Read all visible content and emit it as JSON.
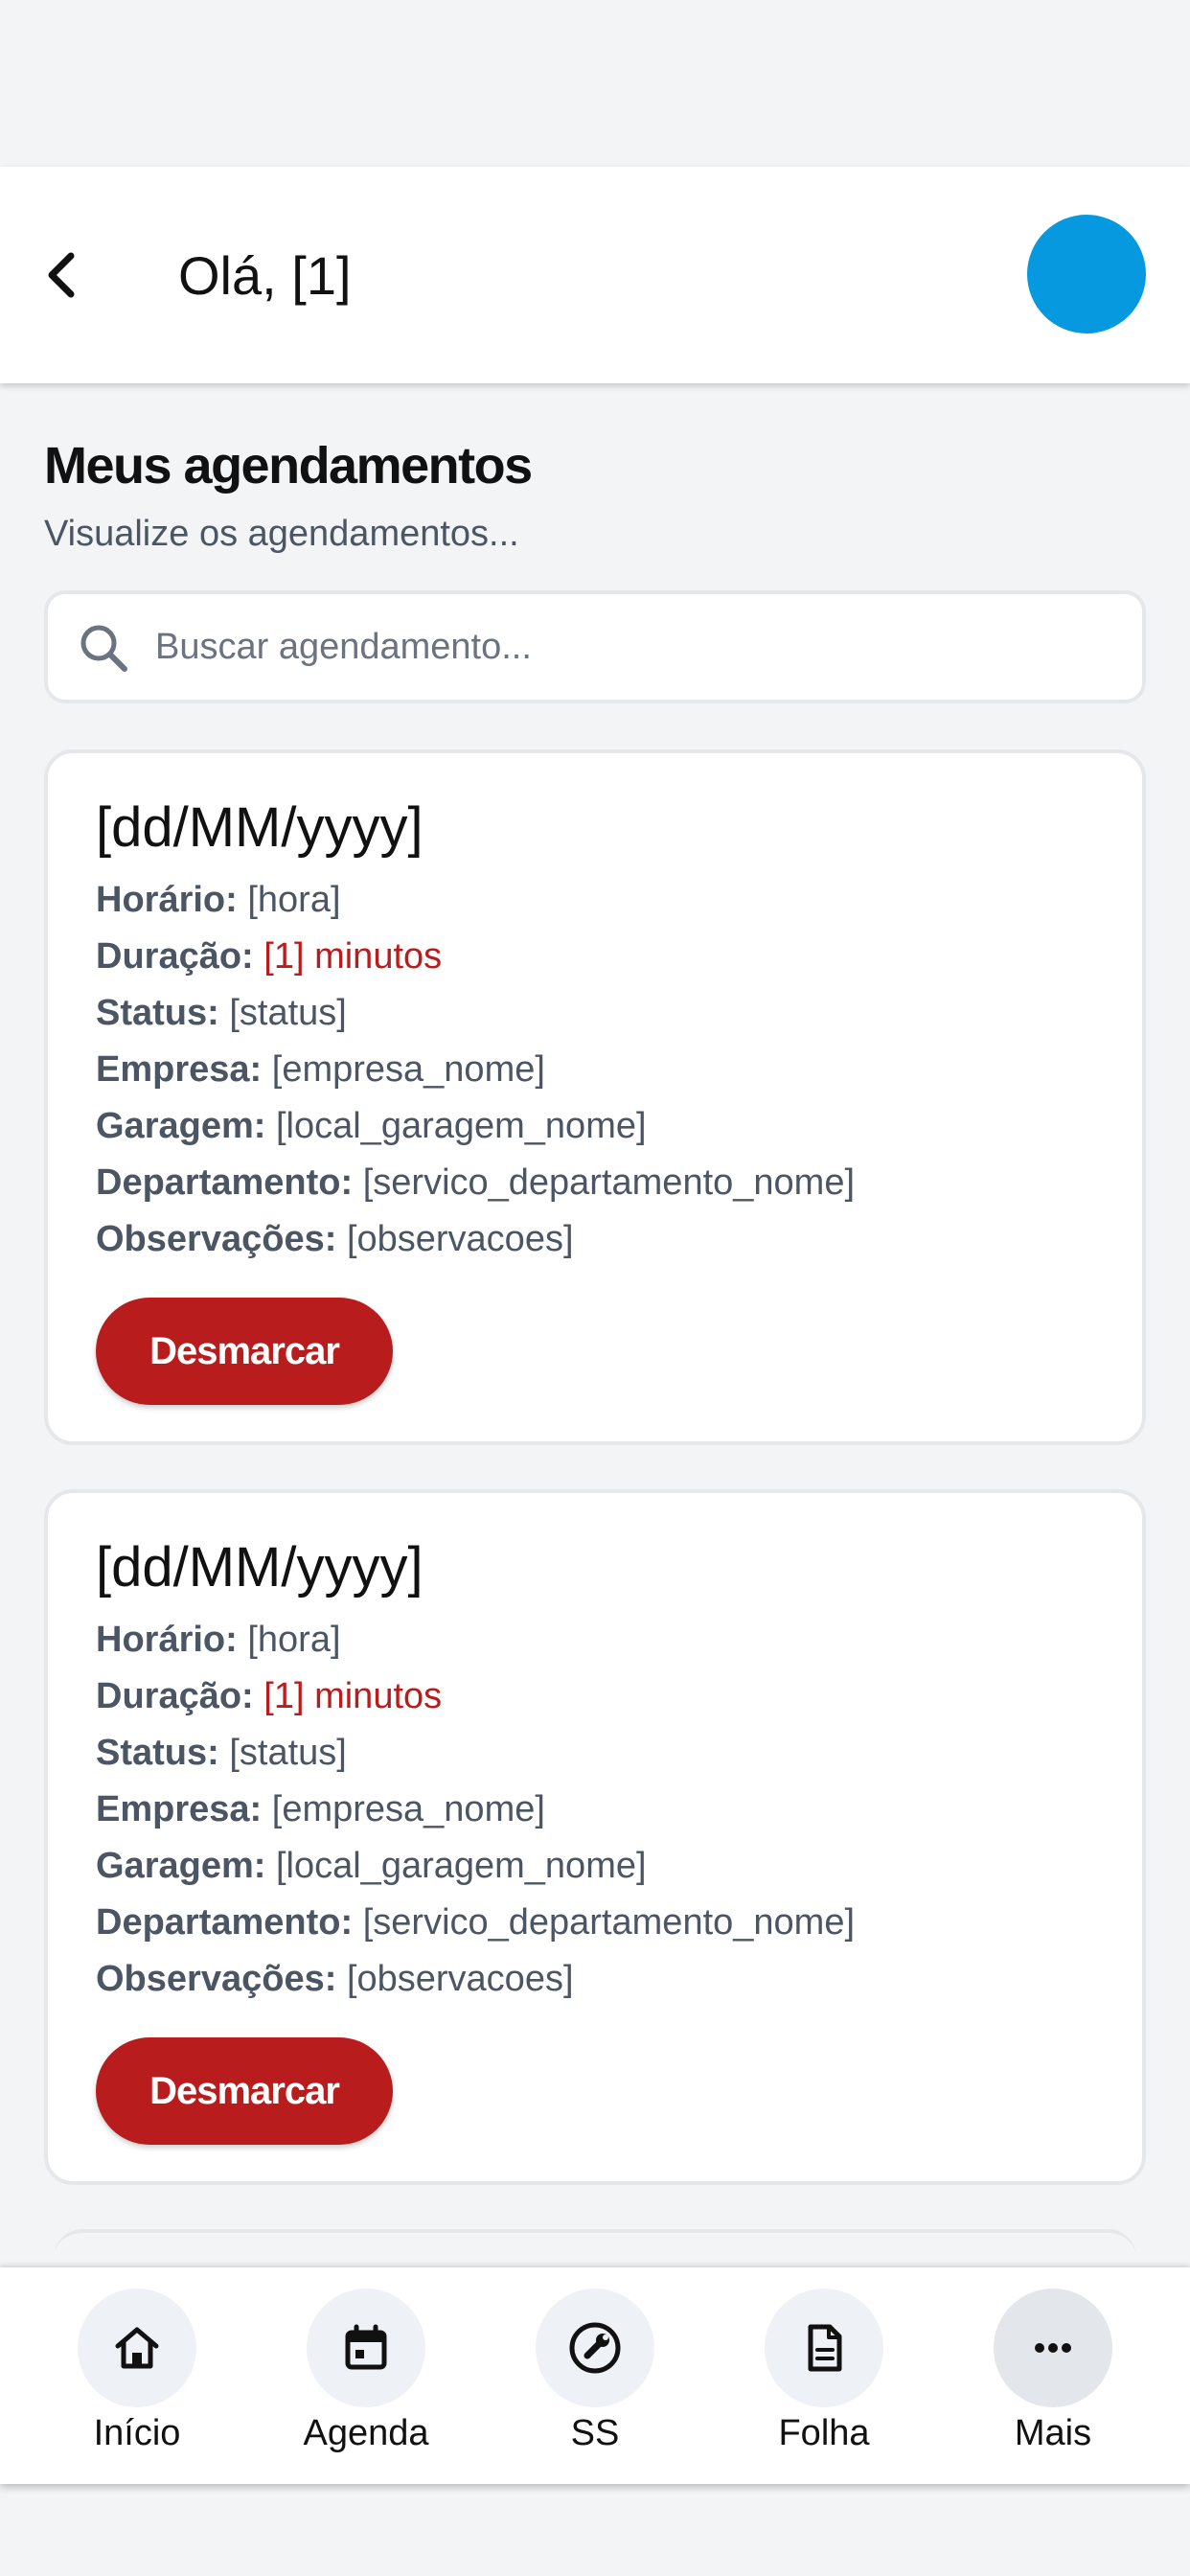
{
  "header": {
    "greeting": "Olá, [1]",
    "avatar_color": "#0799df"
  },
  "page": {
    "title": "Meus agendamentos",
    "subtitle": "Visualize os agendamentos..."
  },
  "search": {
    "placeholder": "Buscar agendamento...",
    "value": ""
  },
  "labels": {
    "horario": "Horário:",
    "duracao": "Duração:",
    "status": "Status:",
    "empresa": "Empresa:",
    "garagem": "Garagem:",
    "departamento": "Departamento:",
    "observacoes": "Observações:"
  },
  "appointments": [
    {
      "date": "[dd/MM/yyyy]",
      "horario": "[hora]",
      "duracao": "[1] minutos",
      "status": "[status]",
      "empresa": "[empresa_nome]",
      "garagem": "[local_garagem_nome]",
      "departamento": "[servico_departamento_nome]",
      "observacoes": "[observacoes]",
      "action_label": "Desmarcar"
    },
    {
      "date": "[dd/MM/yyyy]",
      "horario": "[hora]",
      "duracao": "[1] minutos",
      "status": "[status]",
      "empresa": "[empresa_nome]",
      "garagem": "[local_garagem_nome]",
      "departamento": "[servico_departamento_nome]",
      "observacoes": "[observacoes]",
      "action_label": "Desmarcar"
    }
  ],
  "nav": {
    "items": [
      {
        "label": "Início",
        "icon": "home-icon"
      },
      {
        "label": "Agenda",
        "icon": "calendar-icon"
      },
      {
        "label": "SS",
        "icon": "wrench-icon"
      },
      {
        "label": "Folha",
        "icon": "document-icon"
      },
      {
        "label": "Mais",
        "icon": "more-icon"
      }
    ]
  },
  "colors": {
    "accent_red": "#b91c1c",
    "background": "#f3f4f6"
  }
}
